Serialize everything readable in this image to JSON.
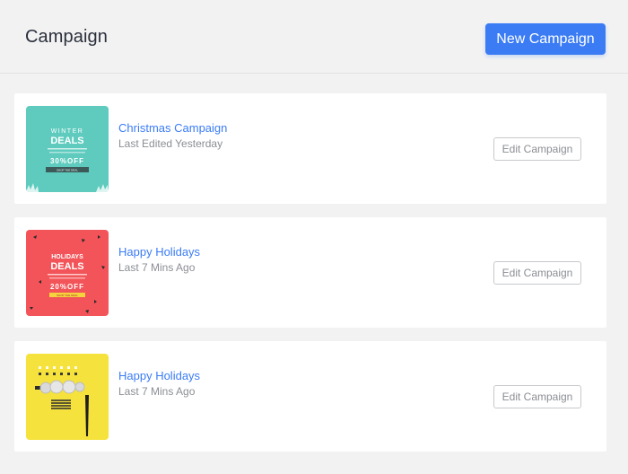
{
  "header": {
    "title": "Campaign",
    "new_button_label": "New Campaign"
  },
  "colors": {
    "accent": "#3b7cf5",
    "page_background": "#f2f2f3"
  },
  "campaigns": [
    {
      "title": "Christmas Campaign",
      "subtitle": "Last Edited Yesterday",
      "edit_label": "Edit Campaign",
      "thumbnail": {
        "background": "#5ecbbe",
        "line1": "WINTER",
        "line2": "DEALS",
        "offer": "30%OFF",
        "cta": "SHOP THE DEAL"
      }
    },
    {
      "title": "Happy Holidays",
      "subtitle": "Last 7 Mins Ago",
      "edit_label": "Edit Campaign",
      "thumbnail": {
        "background": "#f25459",
        "line1": "HOLIDAYS",
        "line2": "DEALS",
        "offer": "20%OFF",
        "cta": "SHOP THE DEAL"
      }
    },
    {
      "title": "Happy Holidays",
      "subtitle": "Last 7 Mins Ago",
      "edit_label": "Edit Campaign",
      "thumbnail": {
        "background": "#f5e23d"
      }
    }
  ]
}
